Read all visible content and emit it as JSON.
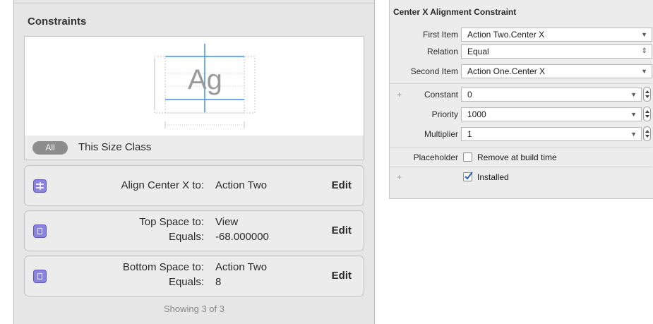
{
  "constraints": {
    "title": "Constraints",
    "preview_text": "Ag",
    "size_toggle": "All",
    "size_class_label": "This Size Class",
    "rows": [
      {
        "label": "Align Center X to:",
        "value": "Action Two",
        "edit": "Edit"
      },
      {
        "label_line1": "Top Space to:",
        "value_line1": "View",
        "label_line2": "Equals:",
        "value_line2": "-68.000000",
        "edit": "Edit"
      },
      {
        "label_line1": "Bottom Space to:",
        "value_line1": "Action Two",
        "label_line2": "Equals:",
        "value_line2": "8",
        "edit": "Edit"
      }
    ],
    "showing": "Showing 3 of 3"
  },
  "inspector": {
    "title": "Center X Alignment Constraint",
    "first_item_label": "First Item",
    "first_item_value": "Action Two.Center X",
    "relation_label": "Relation",
    "relation_value": "Equal",
    "second_item_label": "Second Item",
    "second_item_value": "Action One.Center X",
    "constant_label": "Constant",
    "constant_value": "0",
    "priority_label": "Priority",
    "priority_value": "1000",
    "multiplier_label": "Multiplier",
    "multiplier_value": "1",
    "placeholder_label": "Placeholder",
    "placeholder_checkbox_label": "Remove at build time",
    "placeholder_checked": false,
    "installed_label": "Installed",
    "installed_checked": true,
    "plus_symbol": "+"
  },
  "colors": {
    "accent_blue": "#3d8ee8",
    "constraint_icon": "#8b86dc",
    "checkbox_check": "#2b5fb3"
  }
}
